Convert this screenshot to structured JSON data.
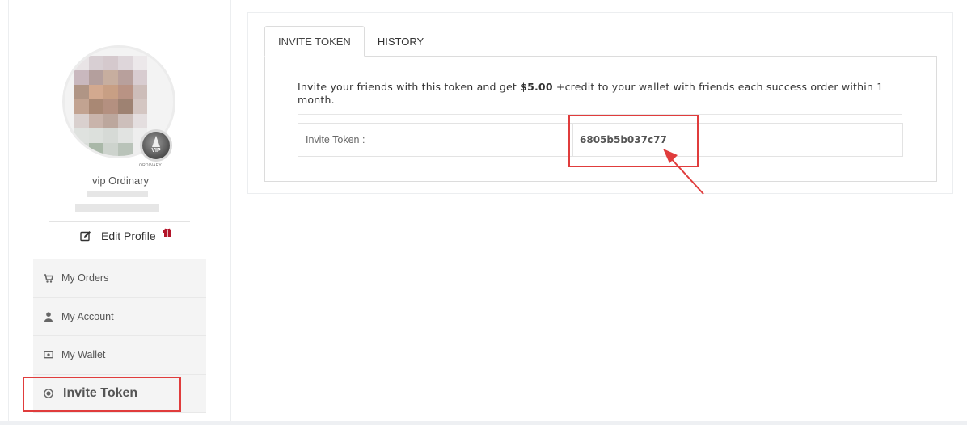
{
  "profile": {
    "vip_badge_text": "VIP",
    "vip_badge_caption": "ORDINARY",
    "vip_level": "vip Ordinary",
    "edit_profile_label": "Edit Profile"
  },
  "sidebar": {
    "items": [
      {
        "label": "My Orders",
        "icon": "cart-icon"
      },
      {
        "label": "My Account",
        "icon": "user-icon"
      },
      {
        "label": "My Wallet",
        "icon": "wallet-icon"
      },
      {
        "label": "Invite Token",
        "icon": "target-icon",
        "active": true
      }
    ]
  },
  "tabs": [
    {
      "label": "INVITE TOKEN",
      "active": true
    },
    {
      "label": "HISTORY",
      "active": false
    }
  ],
  "invite": {
    "desc_prefix": "Invite your friends with this token and get ",
    "desc_amount": "$5.00",
    "desc_suffix": " +credit to your wallet with friends each success order within 1 month.",
    "token_label": "Invite Token :",
    "token_value": "6805b5b037c77"
  },
  "colors": {
    "highlight": "#e03c3c",
    "menu_bg": "#f4f4f4",
    "border": "#dcdcdc"
  }
}
